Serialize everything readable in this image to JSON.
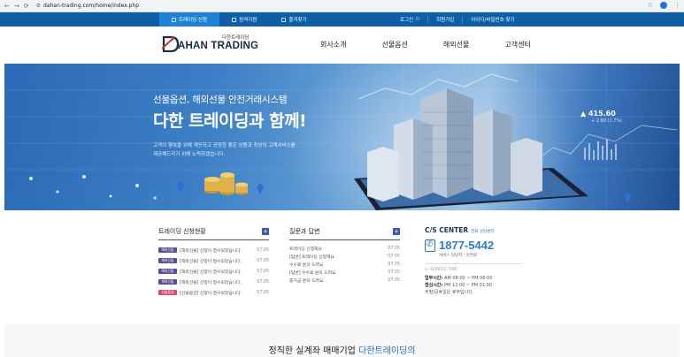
{
  "browser": {
    "url": "dahan-trading.com/home/index.php",
    "nav": [
      "←",
      "→",
      "⟳"
    ],
    "right_icons": [
      "☆",
      "⋮"
    ]
  },
  "topbar": {
    "left": [
      {
        "label": "트레이딩 신청",
        "active": true
      },
      {
        "label": "원격지원",
        "active": false
      },
      {
        "label": "즐겨찾기",
        "active": false
      }
    ],
    "right": [
      "로그인",
      "회원가입",
      "아이디/비밀번호 찾기"
    ]
  },
  "header": {
    "logo_sub": "다한트레이딩",
    "logo_main": "AHAN TRADING",
    "logo_mark": "D",
    "nav": [
      "회사소개",
      "선물옵션",
      "해외선물",
      "고객센터"
    ]
  },
  "hero": {
    "subtitle": "선물옵션, 해외선물 안전거래시스템",
    "title": "다한 트레이딩과 함께!",
    "desc_line1": "고객의 행복을 위해 깨끗하고 공정한 좋은 상품과 최상의 고객서비스를",
    "desc_line2": "제공해드리기 위해 노력하겠습니다.",
    "ticker": "▲ 415.60",
    "ticker_sub": "+ 2.80 (1.7%)"
  },
  "apply": {
    "title": "트레이딩 신청현황",
    "plus": "+",
    "rows": [
      {
        "badge": "해외선물",
        "badge_color": "#5a4a9a",
        "text": "[해외선물] 신청이 접수되었습니다.",
        "date": "07.05"
      },
      {
        "badge": "해외선물",
        "badge_color": "#5a4a9a",
        "text": "[해외선물] 신청이 접수되었습니다.",
        "date": "07.05"
      },
      {
        "badge": "해외선물",
        "badge_color": "#5a4a9a",
        "text": "[해외선물] 신청이 접수되었습니다.",
        "date": "07.05"
      },
      {
        "badge": "해외선물",
        "badge_color": "#5a4a9a",
        "text": "[해외선물] 신청이 접수되었습니다.",
        "date": "07.05"
      },
      {
        "badge": "선물옵션",
        "badge_color": "#d44b7a",
        "text": "[선물옵션] 신청이 접수되었습니다.",
        "date": "07.05"
      }
    ]
  },
  "qna": {
    "title": "질문과 답변",
    "plus": "+",
    "rows": [
      {
        "text": "트레이딩 신청해요",
        "date": "07.05"
      },
      {
        "text": "[답변] 트레이딩 신청해요",
        "date": "07.05"
      },
      {
        "text": "수수료 문의 드려요",
        "date": "07.05"
      },
      {
        "text": "[답변] 수수료 문의 드려요",
        "date": "07.05"
      },
      {
        "text": "증거금 문의 드려요",
        "date": "07.05"
      }
    ]
  },
  "cs": {
    "title": "C/S CENTER",
    "subtitle": "전화 상담센터",
    "phone": "1877-5442",
    "person": "서비스 담당자 : 유연원",
    "service_label": "SERVICE TIME",
    "hours1_label": "업무시간:",
    "hours1": " AM 08:00 ~ PM 06:00",
    "hours2_label": "점심시간:",
    "hours2": " PM 12:00 ~ PM 01:00",
    "hours3": "주말/공휴일은 휴무입니다."
  },
  "bottom": {
    "text": "정직한 실계좌 매매기업 ",
    "highlight": "다한트레이딩의"
  },
  "colors": {
    "topbar": "#0d5fa7",
    "accent": "#2d7ed3",
    "badge_overseas": "#5a4a9a",
    "badge_futures": "#d44b7a"
  }
}
